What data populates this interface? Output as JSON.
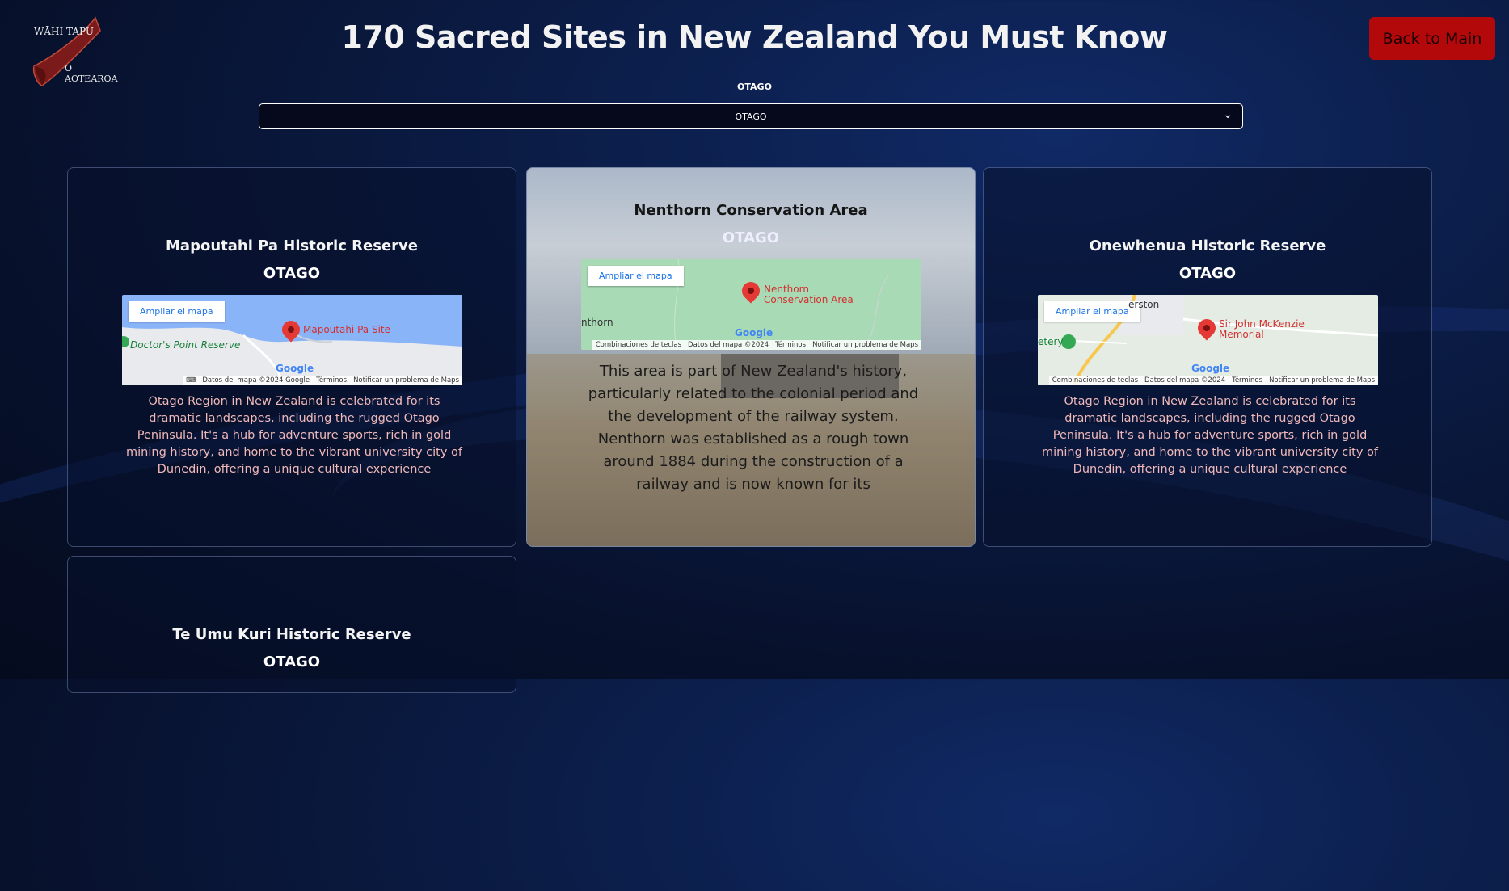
{
  "logo": {
    "line1": "WĀHI TAPU",
    "line2": "O AOTEAROA"
  },
  "header": {
    "title": "170 Sacred Sites in New Zealand You Must Know",
    "back_label": "Back to Main"
  },
  "filter": {
    "label": "OTAGO",
    "selected": "OTAGO"
  },
  "map_ui": {
    "enlarge": "Ampliar el mapa",
    "data": "Datos del mapa ©2024",
    "data_google": "Datos del mapa ©2024 Google",
    "terms": "Términos",
    "report": "Notificar un problema de Maps",
    "shortcuts": "Combinaciones de teclas",
    "google": "Google"
  },
  "cards": [
    {
      "title": "Mapoutahi Pa Historic Reserve",
      "region": "OTAGO",
      "map_pin": "Mapoutahi Pa Site",
      "map_place": "Doctor's Point Reserve",
      "description": "Otago Region in New Zealand is celebrated for its dramatic landscapes, including the rugged Otago Peninsula. It's a hub for adventure sports, rich in gold mining history, and home to the vibrant university city of Dunedin, offering a unique cultural experience"
    },
    {
      "title": "Nenthorn Conservation Area",
      "region": "OTAGO",
      "map_pin": "Nenthorn Conservation Area",
      "map_place": "nthorn",
      "description": "This area is part of New Zealand's history, particularly related to the colonial period and the development of the railway system. Nenthorn was established as a rough town around 1884 during the construction of a railway and is now known for its"
    },
    {
      "title": "Onewhenua Historic Reserve",
      "region": "OTAGO",
      "map_pin": "Sir John McKenzie Memorial",
      "map_place": "erston",
      "map_place2": "etery",
      "description": "Otago Region in New Zealand is celebrated for its dramatic landscapes, including the rugged Otago Peninsula. It's a hub for adventure sports, rich in gold mining history, and home to the vibrant university city of Dunedin, offering a unique cultural experience"
    },
    {
      "title": "Te Umu Kuri Historic Reserve",
      "region": "OTAGO"
    }
  ],
  "colors": {
    "accent": "#b3090b",
    "desc_text": "#f0b9b9",
    "background": "#0b1c46"
  }
}
